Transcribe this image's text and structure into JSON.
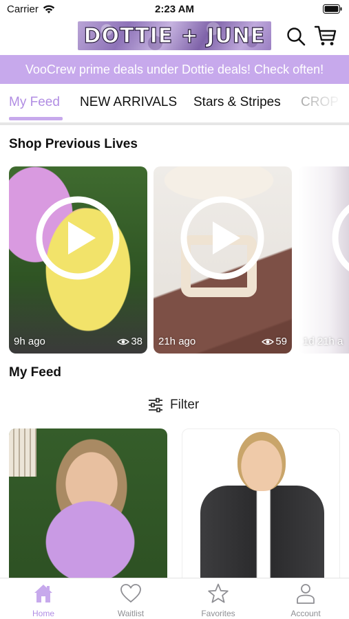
{
  "status_bar": {
    "carrier": "Carrier",
    "time": "2:23 AM"
  },
  "header": {
    "logo_text": "DOTTIE + JUNE",
    "search_icon": "search-icon",
    "cart_icon": "cart-icon"
  },
  "banner": {
    "text": "VooCrew prime deals under Dottie deals! Check often!"
  },
  "tabs": [
    {
      "label": "My Feed",
      "active": true
    },
    {
      "label": "NEW ARRIVALS",
      "active": false
    },
    {
      "label": "Stars & Stripes",
      "active": false
    },
    {
      "label": "CROP",
      "active": false
    }
  ],
  "previous_lives": {
    "title": "Shop Previous Lives",
    "items": [
      {
        "time": "9h ago",
        "views": "38"
      },
      {
        "time": "21h ago",
        "views": "59"
      },
      {
        "time": "1d 21h a",
        "views": ""
      }
    ]
  },
  "feed": {
    "title": "My Feed",
    "filter_label": "Filter",
    "filter_icon": "sliders-icon"
  },
  "tabbar": {
    "items": [
      {
        "label": "Home",
        "icon": "home-icon",
        "active": true
      },
      {
        "label": "Waitlist",
        "icon": "heart-icon",
        "active": false
      },
      {
        "label": "Favorites",
        "icon": "star-icon",
        "active": false
      },
      {
        "label": "Account",
        "icon": "person-icon",
        "active": false
      }
    ]
  },
  "colors": {
    "accent": "#c7a9ec",
    "accent_text": "#b18de3",
    "inactive_tab": "#8e8e93"
  }
}
